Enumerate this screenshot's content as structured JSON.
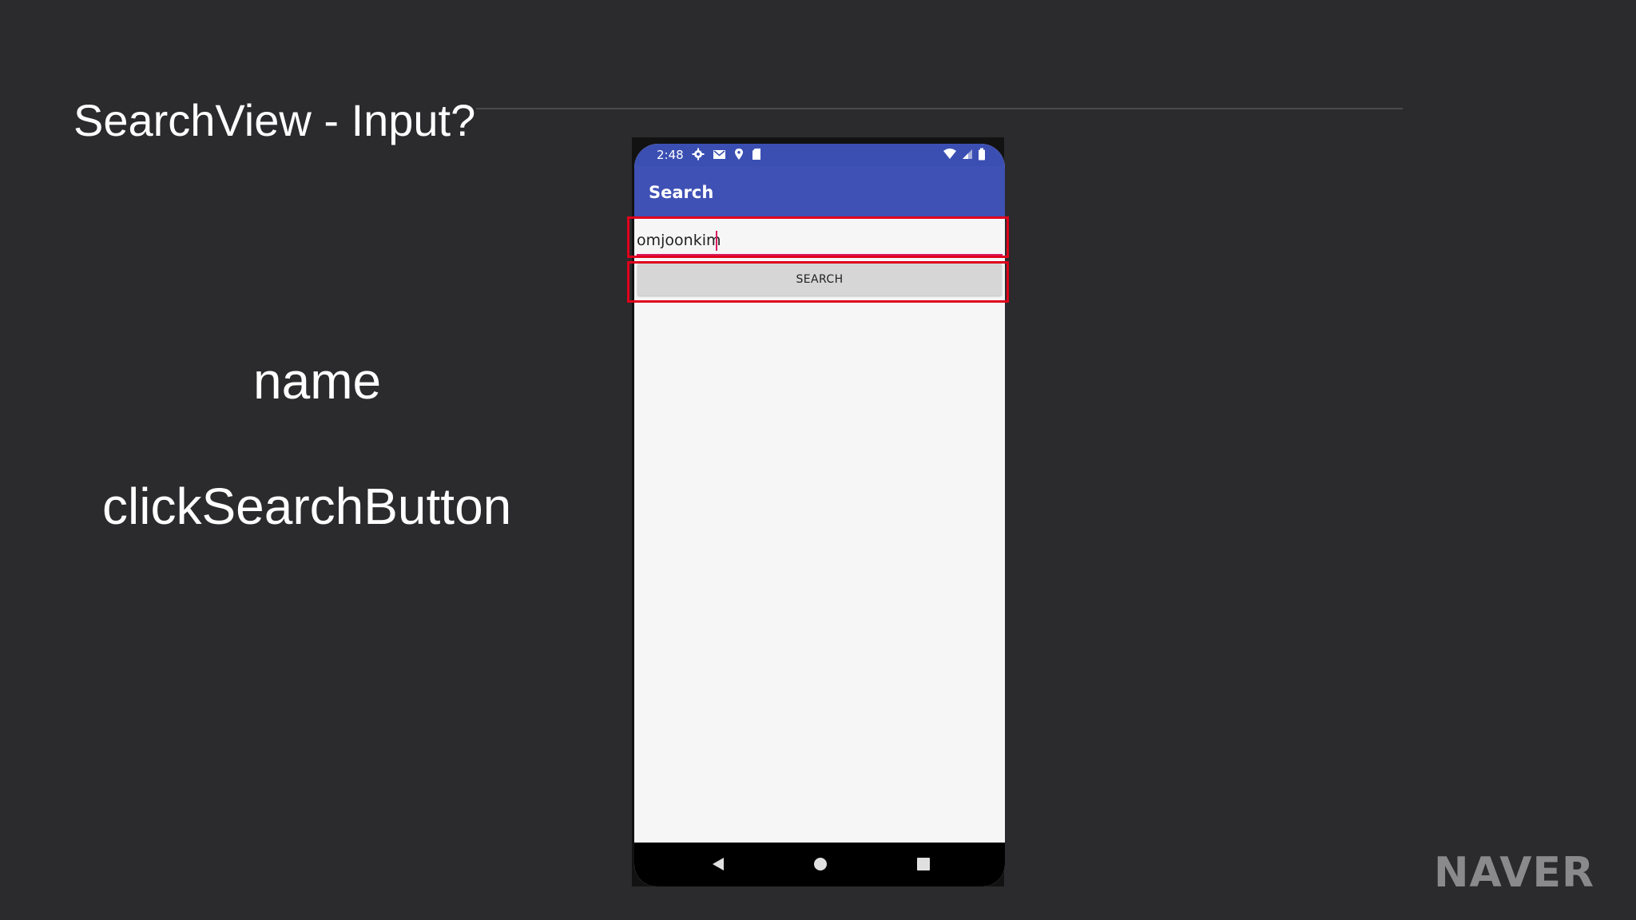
{
  "slide": {
    "title": "SearchView - Input?",
    "label_name": "name",
    "label_click": "clickSearchButton",
    "brand": "NAVER"
  },
  "phone": {
    "status_bar": {
      "time": "2:48",
      "left_icons": [
        "settings-icon",
        "gmail-icon",
        "location-icon",
        "sd-card-icon"
      ],
      "right_icons": [
        "wifi-icon",
        "cell-signal-icon",
        "battery-icon"
      ]
    },
    "app_bar": {
      "title": "Search"
    },
    "search_input": {
      "value": "omjoonkim",
      "placeholder": ""
    },
    "search_button": {
      "label": "SEARCH"
    },
    "nav_bar": {
      "items": [
        "back-icon",
        "home-icon",
        "recents-icon"
      ]
    }
  },
  "colors": {
    "slide_background": "#2b2b2d",
    "app_bar": "#3f51b5",
    "accent": "#d81b60",
    "highlight": "#e0001b",
    "button": "#d6d6d6"
  }
}
